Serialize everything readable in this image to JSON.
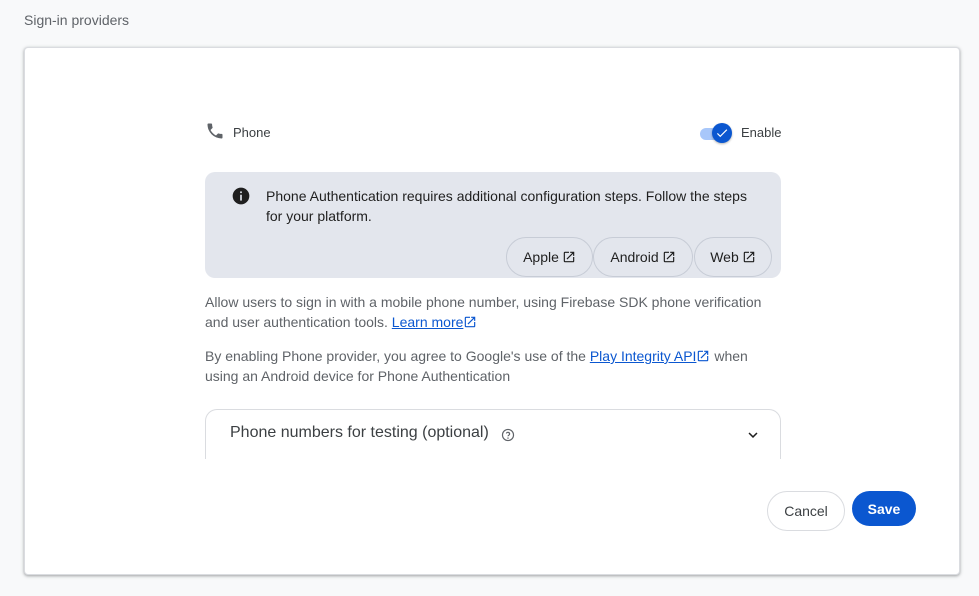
{
  "section_title": "Sign-in providers",
  "provider": {
    "name": "Phone",
    "icon": "phone-icon",
    "enable_label": "Enable",
    "enabled": true
  },
  "info": {
    "icon": "info-icon",
    "text": "Phone Authentication requires additional configuration steps. Follow the steps for your platform.",
    "buttons": [
      {
        "label": "Apple",
        "icon": "external-link-icon"
      },
      {
        "label": "Android",
        "icon": "external-link-icon"
      },
      {
        "label": "Web",
        "icon": "external-link-icon"
      }
    ]
  },
  "description": {
    "text": "Allow users to sign in with a mobile phone number, using Firebase SDK phone verification and user authentication tools.",
    "link": "Learn more"
  },
  "integrity": {
    "prefix": "By enabling Phone provider, you agree to Google's use of the",
    "link": "Play Integrity API",
    "suffix": "when using an Android device for Phone Authentication"
  },
  "testing": {
    "title": "Phone numbers for testing (optional)",
    "help_icon": "help-icon",
    "chevron_icon": "chevron-down-icon"
  },
  "actions": {
    "cancel": "Cancel",
    "save": "Save"
  },
  "colors": {
    "accent": "#0b57d0",
    "info_bg": "#e3e6ed",
    "toggle_track": "#a8c7fa"
  }
}
